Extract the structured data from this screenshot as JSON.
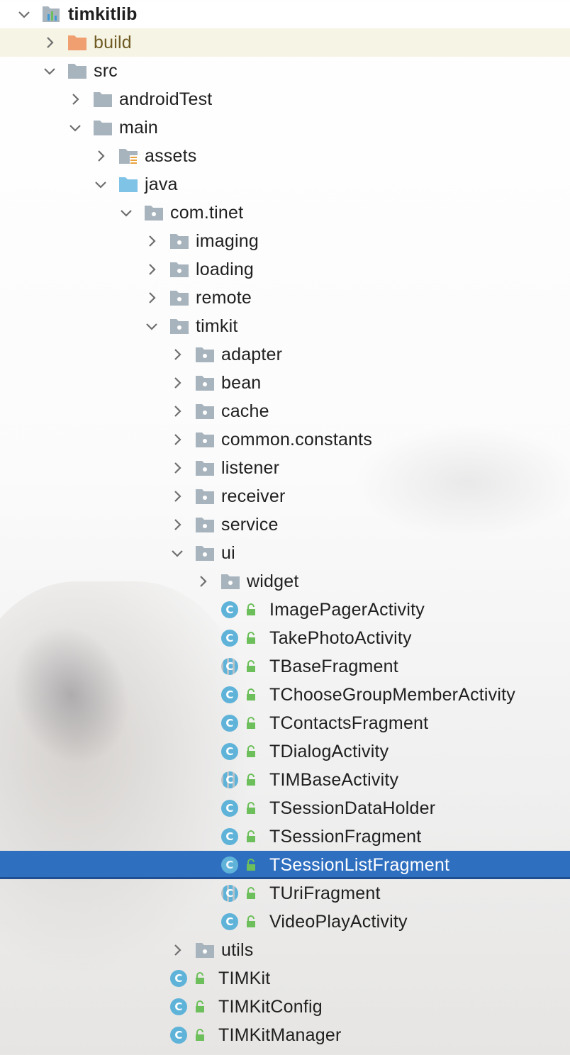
{
  "tree": [
    {
      "label": "timkitlib",
      "kind": "module",
      "expanded": true
    },
    {
      "label": "build",
      "kind": "folder-excluded",
      "expanded": false
    },
    {
      "label": "src",
      "kind": "folder",
      "expanded": true
    },
    {
      "label": "androidTest",
      "kind": "folder",
      "expanded": false
    },
    {
      "label": "main",
      "kind": "folder",
      "expanded": true
    },
    {
      "label": "assets",
      "kind": "folder-resources",
      "expanded": false
    },
    {
      "label": "java",
      "kind": "folder-source",
      "expanded": true
    },
    {
      "label": "com.tinet",
      "kind": "package",
      "expanded": true
    },
    {
      "label": "imaging",
      "kind": "package",
      "expanded": false
    },
    {
      "label": "loading",
      "kind": "package",
      "expanded": false
    },
    {
      "label": "remote",
      "kind": "package",
      "expanded": false
    },
    {
      "label": "timkit",
      "kind": "package",
      "expanded": true
    },
    {
      "label": "adapter",
      "kind": "package",
      "expanded": false
    },
    {
      "label": "bean",
      "kind": "package",
      "expanded": false
    },
    {
      "label": "cache",
      "kind": "package",
      "expanded": false
    },
    {
      "label": "common.constants",
      "kind": "package",
      "expanded": false
    },
    {
      "label": "listener",
      "kind": "package",
      "expanded": false
    },
    {
      "label": "receiver",
      "kind": "package",
      "expanded": false
    },
    {
      "label": "service",
      "kind": "package",
      "expanded": false
    },
    {
      "label": "ui",
      "kind": "package",
      "expanded": true
    },
    {
      "label": "widget",
      "kind": "package",
      "expanded": false
    },
    {
      "label": "ImagePagerActivity",
      "kind": "class",
      "icon_text": "C"
    },
    {
      "label": "TakePhotoActivity",
      "kind": "class",
      "icon_text": "C"
    },
    {
      "label": "TBaseFragment",
      "kind": "abstract-class",
      "icon_text": "C"
    },
    {
      "label": "TChooseGroupMemberActivity",
      "kind": "class",
      "icon_text": "C"
    },
    {
      "label": "TContactsFragment",
      "kind": "class",
      "icon_text": "C"
    },
    {
      "label": "TDialogActivity",
      "kind": "class",
      "icon_text": "C"
    },
    {
      "label": "TIMBaseActivity",
      "kind": "abstract-class",
      "icon_text": "C"
    },
    {
      "label": "TSessionDataHolder",
      "kind": "class",
      "icon_text": "C"
    },
    {
      "label": "TSessionFragment",
      "kind": "class",
      "icon_text": "C"
    },
    {
      "label": "TSessionListFragment",
      "kind": "class",
      "icon_text": "C",
      "selected": true
    },
    {
      "label": "TUriFragment",
      "kind": "abstract-class",
      "icon_text": "C"
    },
    {
      "label": "VideoPlayActivity",
      "kind": "class",
      "icon_text": "C"
    },
    {
      "label": "utils",
      "kind": "package",
      "expanded": false
    },
    {
      "label": "TIMKit",
      "kind": "class",
      "icon_text": "C"
    },
    {
      "label": "TIMKitConfig",
      "kind": "class",
      "icon_text": "C"
    },
    {
      "label": "TIMKitManager",
      "kind": "class",
      "icon_text": "C"
    }
  ],
  "colors": {
    "selection": "#2f6fc0",
    "excluded_highlight": "#f6f4e4",
    "folder_gray": "#a8b4bd",
    "folder_excluded": "#f0a070",
    "folder_source": "#7fc3e6",
    "class_icon": "#5fb3d9",
    "lock_green": "#6cbf5a"
  }
}
